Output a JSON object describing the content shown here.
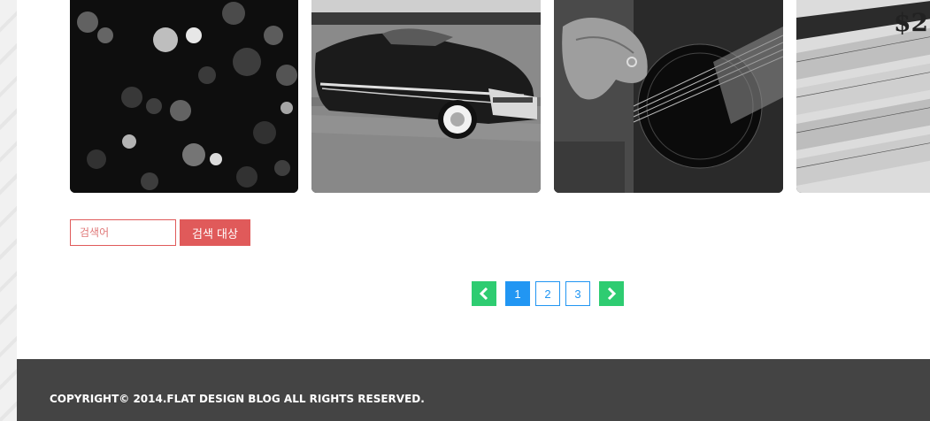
{
  "gallery": {
    "images": [
      {
        "name": "bokeh-lights-photo"
      },
      {
        "name": "classic-car-photo"
      },
      {
        "name": "guitar-photo"
      },
      {
        "name": "banknotes-photo"
      }
    ]
  },
  "search": {
    "placeholder": "검색어",
    "button_label": "검색 대상"
  },
  "pagination": {
    "prev_icon": "chevron-left-icon",
    "next_icon": "chevron-right-icon",
    "pages": [
      "1",
      "2",
      "3"
    ],
    "current_page": "1",
    "colors": {
      "arrow": "#2ecc71",
      "active": "#2196f3"
    }
  },
  "footer": {
    "copyright": "COPYRIGHT© 2014.FLAT DESIGN BLOG ALL RIGHTS RESERVED."
  },
  "colors": {
    "accent_red": "#e05a5a",
    "footer_bg": "#444444"
  }
}
